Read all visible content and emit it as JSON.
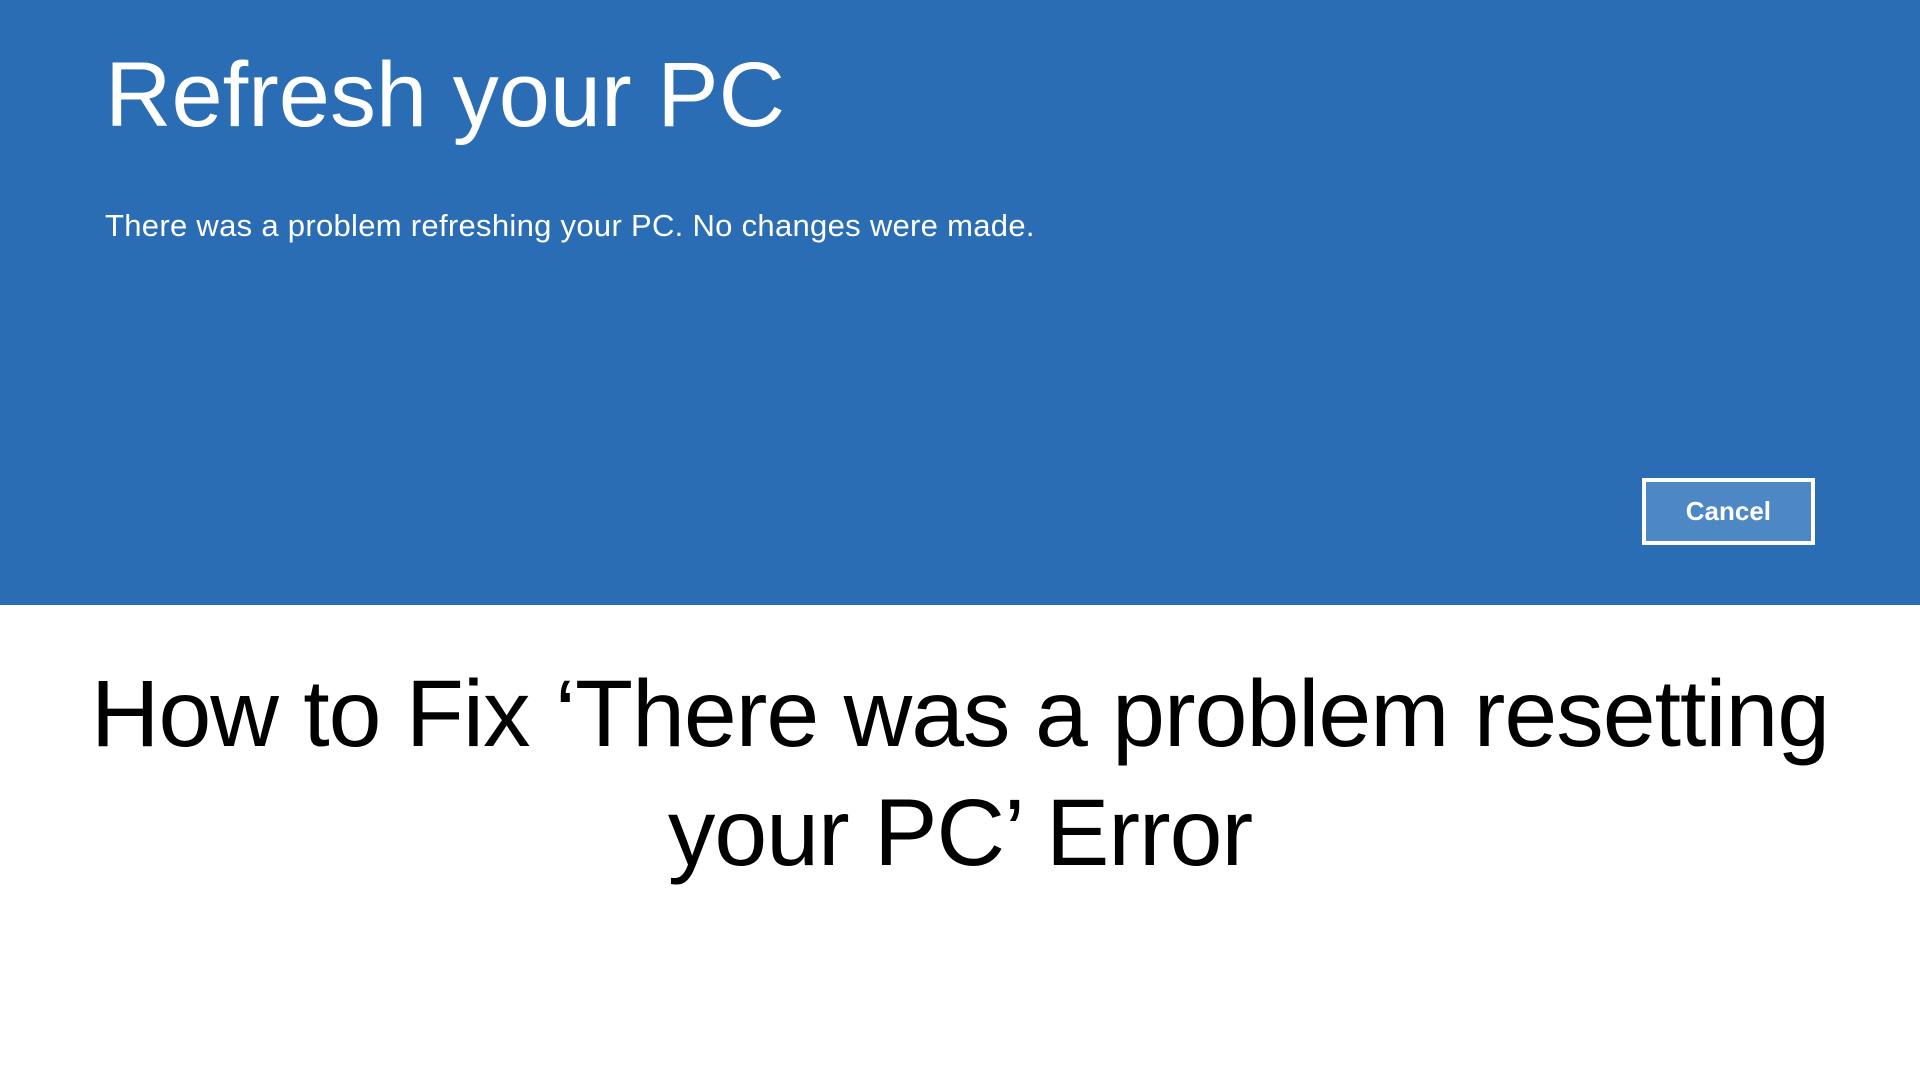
{
  "dialog": {
    "title": "Refresh your PC",
    "message": "There was a problem refreshing your PC. No changes were made.",
    "cancel_label": "Cancel"
  },
  "article": {
    "title": "How to Fix ‘There was a problem resetting your PC’ Error"
  },
  "colors": {
    "panel_background": "#2a6db4",
    "button_background": "#4d88c4",
    "button_border": "#ffffff",
    "text_light": "#ffffff",
    "text_dark": "#000000"
  }
}
